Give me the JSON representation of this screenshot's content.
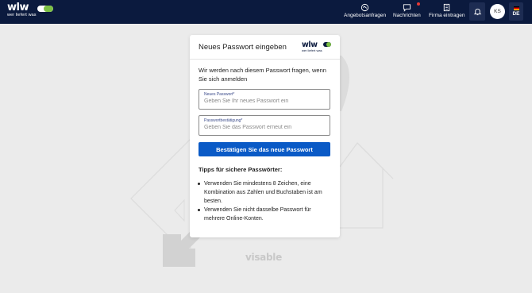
{
  "header": {
    "logo_word": "wlw",
    "logo_sub": "wer liefert was",
    "nav": [
      {
        "label": "Angebotsanfragen",
        "icon": "handshake-icon"
      },
      {
        "label": "Nachrichten",
        "icon": "chat-icon"
      },
      {
        "label": "Firma eintragen",
        "icon": "building-icon"
      }
    ],
    "avatar_initials": "KS",
    "language": "DE"
  },
  "card": {
    "title": "Neues Passwort eingeben",
    "logo_word": "wlw",
    "logo_sub": "wer liefert was",
    "intro": "Wir werden nach diesem Passwort fragen, wenn Sie sich anmelden",
    "new_password": {
      "label": "Neues Passwort*",
      "placeholder": "Geben Sie Ihr neues Passwort ein",
      "value": ""
    },
    "confirm_password": {
      "label": "Passwortbestätigung*",
      "placeholder": "Geben Sie das Passwort erneut ein",
      "value": ""
    },
    "submit_label": "Bestätigen Sie das neue Passwort",
    "tips_title": "Tipps für sichere Passwörter:",
    "tips": [
      "Verwenden Sie mindestens 8 Zeichen, eine Kombination aus Zahlen und Buchstaben ist am besten.",
      "Verwenden Sie nicht dasselbe Passwort für mehrere Online-Konten."
    ]
  },
  "footer_logo": "visable",
  "colors": {
    "header_bg": "#0b1a3e",
    "primary": "#0a5ac6",
    "brand_green": "#7bc043",
    "page_bg": "#ebebeb"
  }
}
